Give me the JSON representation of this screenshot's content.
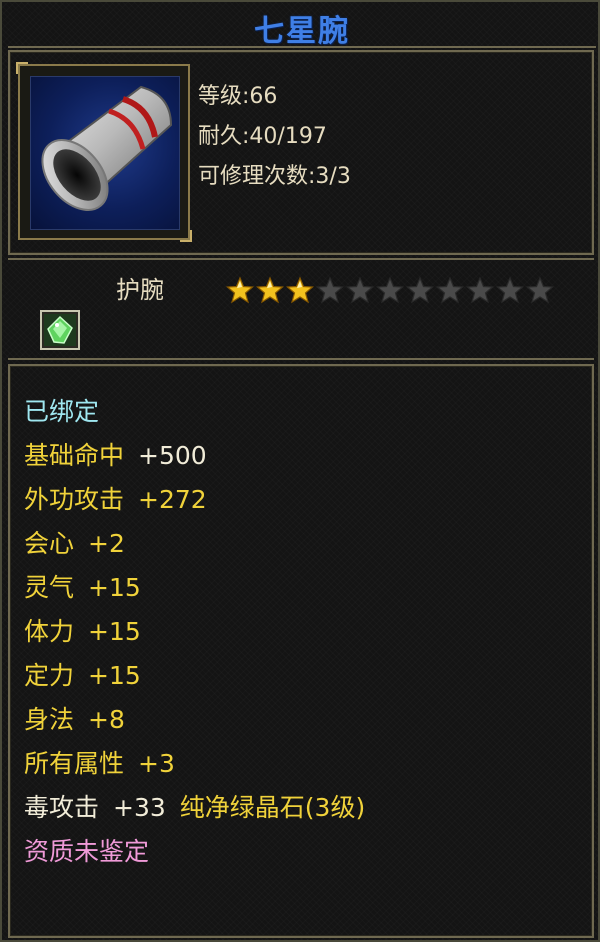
{
  "item": {
    "name": "七星腕",
    "title_color": "#3f7fe6",
    "icon": "bracer-icon",
    "stats": {
      "level": "等级:66",
      "durability": "耐久:40/197",
      "repair": "可修理次数:3/3"
    },
    "type": "护腕",
    "stars_filled": 3,
    "stars_total": 11,
    "gem_slot_icon": "green-gem-icon"
  },
  "attributes": {
    "bound": "已绑定",
    "hit": {
      "name": "基础命中",
      "value": "+500"
    },
    "attack": {
      "name": "外功攻击",
      "value": "+272"
    },
    "crit": {
      "name": "会心",
      "value": "+2"
    },
    "spirit": {
      "name": "灵气",
      "value": "+15"
    },
    "stamina": {
      "name": "体力",
      "value": "+15"
    },
    "focus": {
      "name": "定力",
      "value": "+15"
    },
    "agility": {
      "name": "身法",
      "value": "+8"
    },
    "all": {
      "name": "所有属性",
      "value": "+3"
    },
    "poison": {
      "name": "毒攻击",
      "value": "+33",
      "gem": "纯净绿晶石(3级)"
    },
    "quality": "资质未鉴定"
  }
}
